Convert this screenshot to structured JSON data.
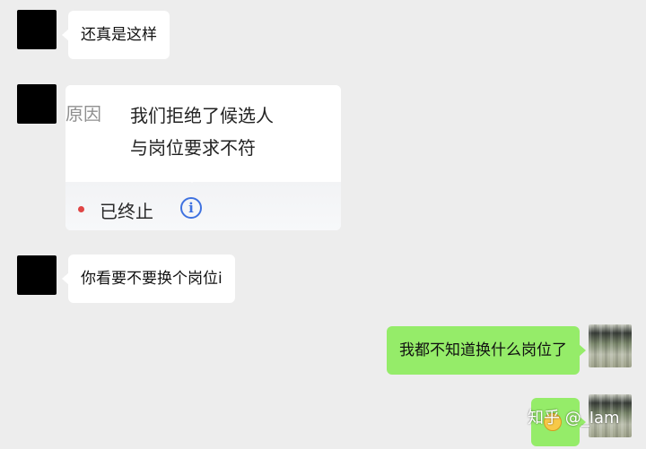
{
  "messages": {
    "m1": {
      "text": "还真是这样"
    },
    "card": {
      "reason_label": "原因",
      "reason_line1": "我们拒绝了候选人",
      "reason_line2": "与岗位要求不符",
      "status_text": "已终止",
      "info_icon": "ⓘ"
    },
    "m3": {
      "text": "你看要不要换个岗位i"
    },
    "m4": {
      "text": "我都不知道换什么岗位了"
    }
  },
  "watermark": "知乎 @_Iam"
}
